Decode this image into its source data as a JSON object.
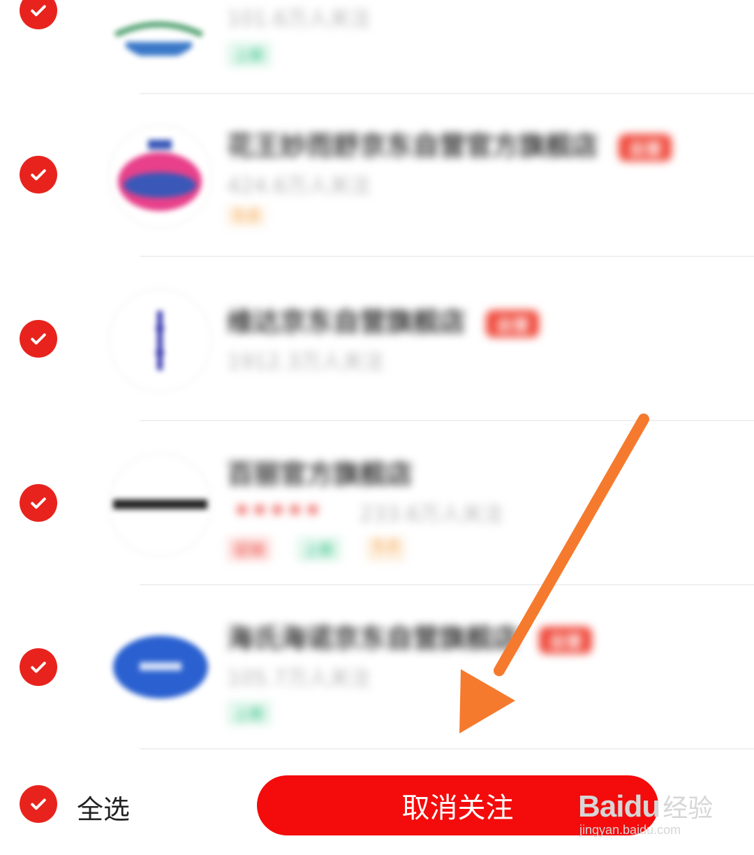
{
  "stores": [
    {
      "name": "",
      "fans": "101.6万人关注",
      "badge": "",
      "tags": [
        {
          "label": "上新",
          "color": "green"
        }
      ],
      "rating": ""
    },
    {
      "name": "花王妙而舒京东自营官方旗舰店",
      "fans": "424.6万人关注",
      "badge": "自营",
      "tags": [
        {
          "label": "5.0",
          "color": "orange"
        }
      ],
      "rating": ""
    },
    {
      "name": "维达京东自营旗舰店",
      "fans": "1912.3万人关注",
      "badge": "自营",
      "tags": [],
      "rating": ""
    },
    {
      "name": "百丽官方旗舰店",
      "fans": "233.6万人关注",
      "badge": "",
      "tags": [
        {
          "label": "促销",
          "color": "red"
        },
        {
          "label": "上新",
          "color": "green"
        },
        {
          "label": "5.0",
          "color": "orange"
        }
      ],
      "rating": "★★★★★"
    },
    {
      "name": "海氏海诺京东自营旗舰店",
      "fans": "105.7万人关注",
      "badge": "自营",
      "tags": [
        {
          "label": "上新",
          "color": "green"
        }
      ],
      "rating": ""
    }
  ],
  "footer": {
    "select_all_label": "全选",
    "unfollow_label": "取消关注"
  },
  "watermark": {
    "brand": "Bai",
    "brand_suffix": "du",
    "text": "经验",
    "url": "jingyan.baidu.com"
  },
  "colors": {
    "accent_red": "#e8231d",
    "button_red": "#f40b0b",
    "annotation_arrow": "#f57a2e"
  },
  "icons": {
    "check": "checkmark-icon",
    "arrow": "annotation-arrow"
  }
}
